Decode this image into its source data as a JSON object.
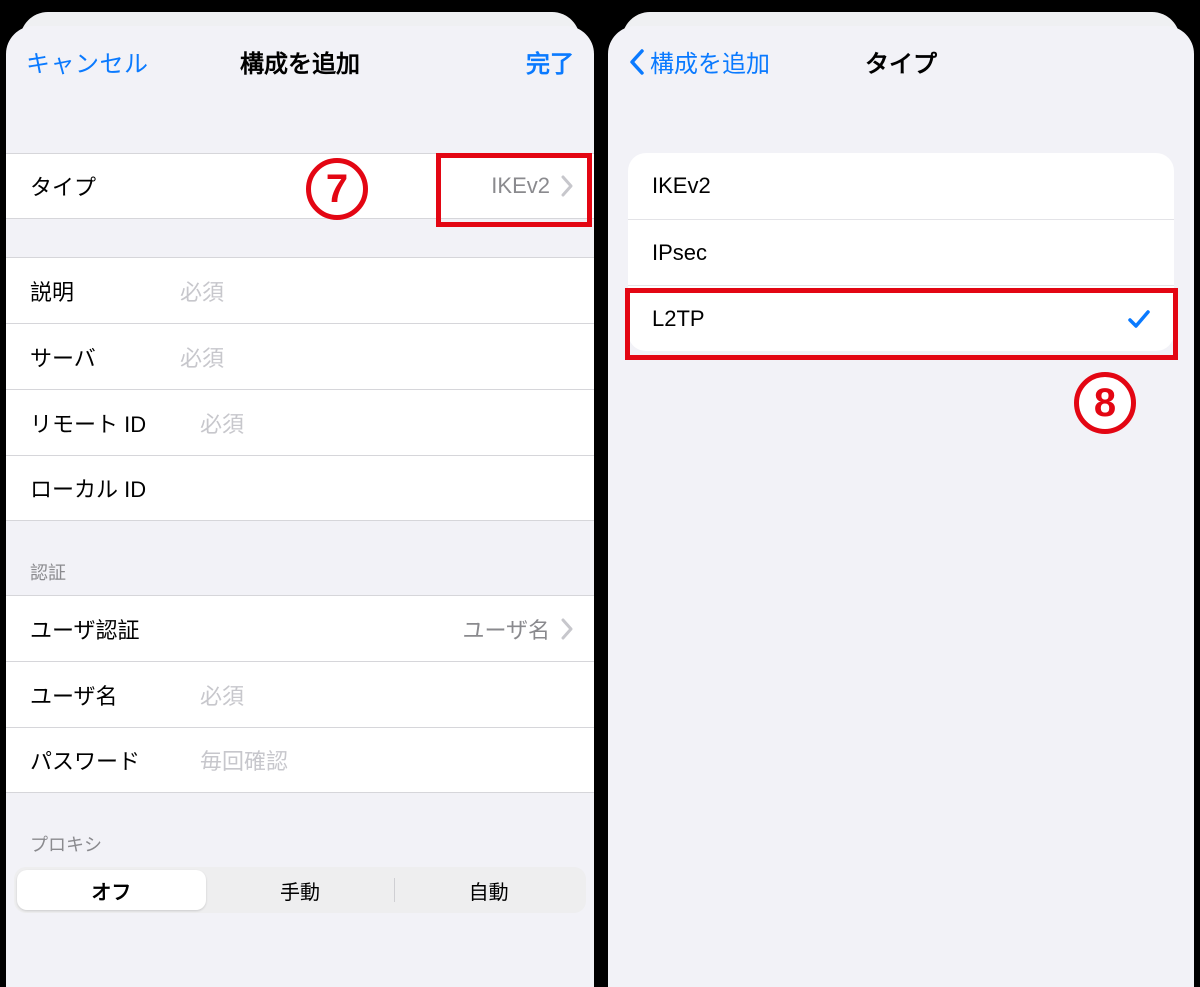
{
  "colors": {
    "accent": "#0a7aff",
    "annotation": "#e30613"
  },
  "left": {
    "nav": {
      "cancel": "キャンセル",
      "title": "構成を追加",
      "done": "完了"
    },
    "type_row": {
      "label": "タイプ",
      "value": "IKEv2"
    },
    "fields": [
      {
        "label": "説明",
        "placeholder": "必須"
      },
      {
        "label": "サーバ",
        "placeholder": "必須"
      },
      {
        "label": "リモート ID",
        "placeholder": "必須"
      },
      {
        "label": "ローカル ID",
        "placeholder": ""
      }
    ],
    "auth_header": "認証",
    "auth_rows": {
      "user_auth": {
        "label": "ユーザ認証",
        "value": "ユーザ名"
      },
      "username": {
        "label": "ユーザ名",
        "placeholder": "必須"
      },
      "password": {
        "label": "パスワード",
        "placeholder": "毎回確認"
      }
    },
    "proxy_header": "プロキシ",
    "proxy_segments": {
      "off": "オフ",
      "manual": "手動",
      "auto": "自動",
      "selected": 0
    }
  },
  "right": {
    "nav": {
      "back": "構成を追加",
      "title": "タイプ"
    },
    "options": [
      {
        "label": "IKEv2",
        "selected": false
      },
      {
        "label": "IPsec",
        "selected": false
      },
      {
        "label": "L2TP",
        "selected": true
      }
    ]
  },
  "annotations": {
    "badge7": "7",
    "badge8": "8"
  }
}
